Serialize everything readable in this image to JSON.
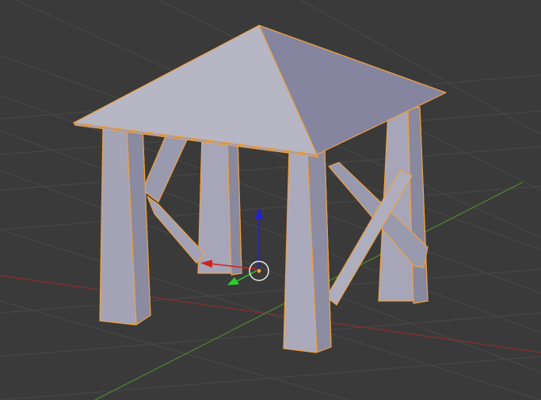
{
  "app": {
    "window": "3D Viewport"
  },
  "scene": {
    "object": "gazebo-mesh",
    "selected": true,
    "selection_outline_color": "#f0a040",
    "mesh_face_light": "#b4b4c2",
    "mesh_face_mid": "#9a9aae",
    "mesh_face_dark": "#80809a",
    "background_color": "#3a3a3a",
    "grid_color": "#494949",
    "axis_x_color": "#8c2e2e",
    "axis_y_color": "#4e8a2c"
  },
  "gizmo": {
    "type": "translate",
    "x_axis_color": "#d41f1f",
    "y_axis_color": "#2ecc2e",
    "z_axis_color": "#2020d8",
    "pivot_color": "#f0a040"
  },
  "icons": {
    "gizmo_x": "arrow-x-icon",
    "gizmo_y": "arrow-y-icon",
    "gizmo_z": "arrow-z-icon",
    "pivot": "origin-pivot-icon"
  }
}
